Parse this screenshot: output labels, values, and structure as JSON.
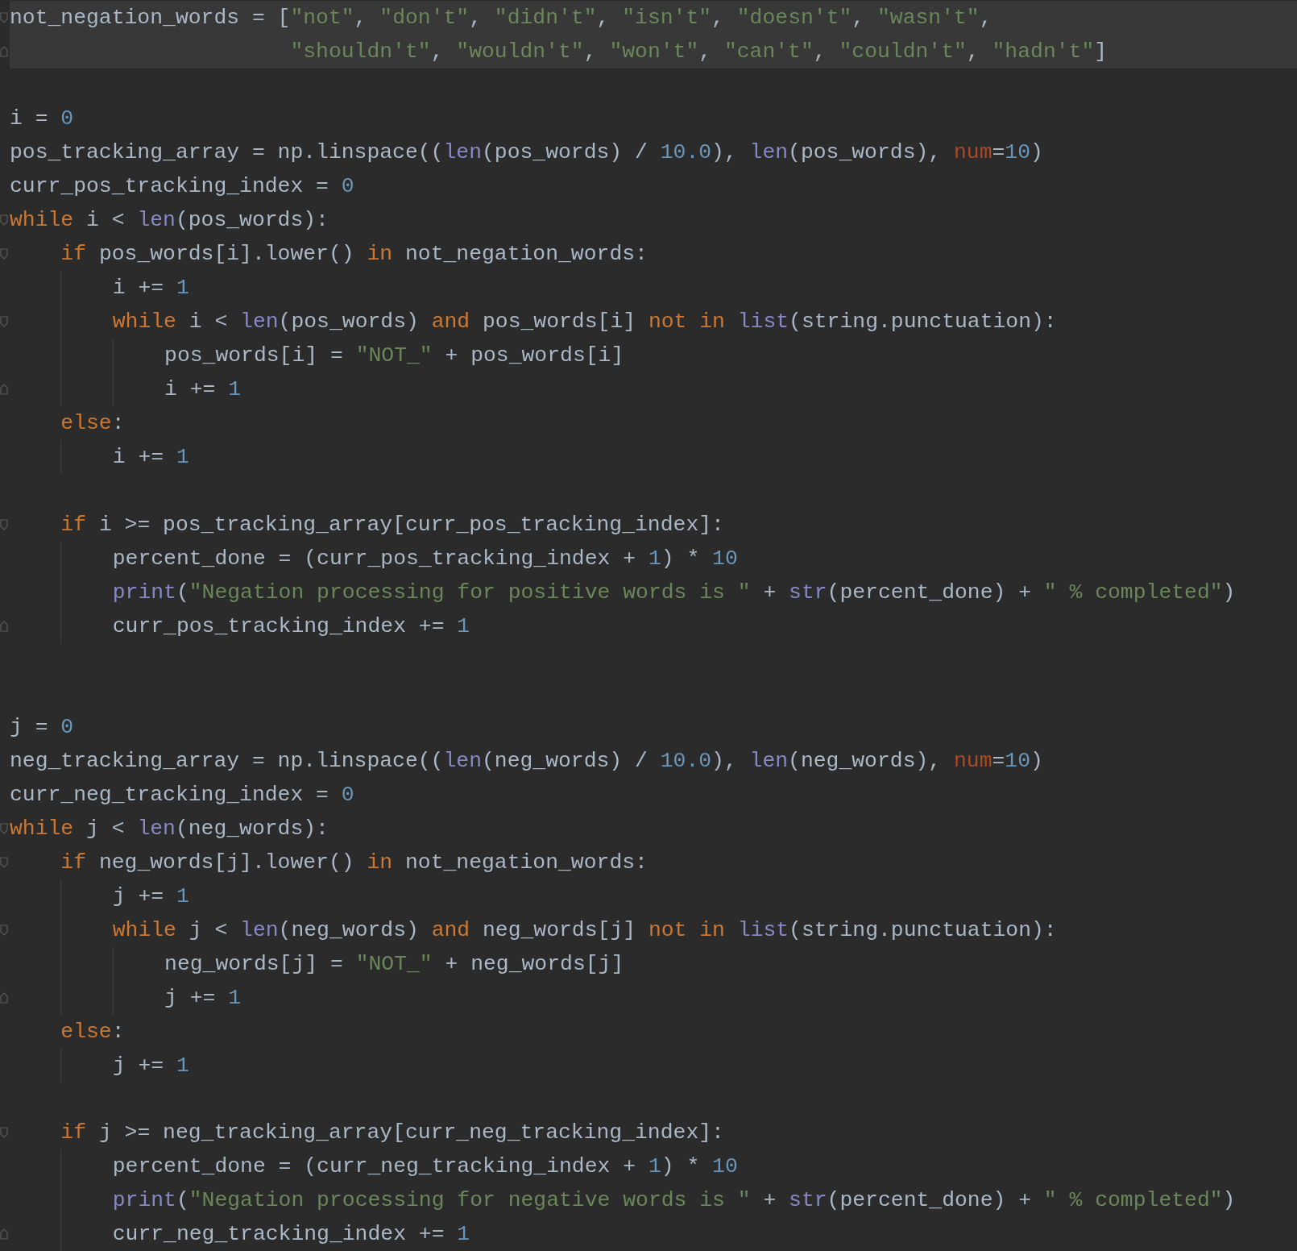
{
  "editor": {
    "lines": [
      {
        "kind": "code",
        "highlighted": true,
        "fold_open": true,
        "fold_close": false,
        "tokens": [
          {
            "kind": "plain",
            "text": "not_negation_words = ["
          },
          {
            "kind": "string",
            "text": "\"not\""
          },
          {
            "kind": "plain",
            "text": ", "
          },
          {
            "kind": "string",
            "text": "\"don't\""
          },
          {
            "kind": "plain",
            "text": ", "
          },
          {
            "kind": "string",
            "text": "\"didn't\""
          },
          {
            "kind": "plain",
            "text": ", "
          },
          {
            "kind": "string",
            "text": "\"isn't\""
          },
          {
            "kind": "plain",
            "text": ", "
          },
          {
            "kind": "string",
            "text": "\"doesn't\""
          },
          {
            "kind": "plain",
            "text": ", "
          },
          {
            "kind": "string",
            "text": "\"wasn't\""
          },
          {
            "kind": "plain",
            "text": ","
          }
        ]
      },
      {
        "kind": "code",
        "highlighted": true,
        "fold_open": false,
        "fold_close": true,
        "tokens": [
          {
            "kind": "string",
            "text": "                      \"shouldn't\""
          },
          {
            "kind": "plain",
            "text": ", "
          },
          {
            "kind": "string",
            "text": "\"wouldn't\""
          },
          {
            "kind": "plain",
            "text": ", "
          },
          {
            "kind": "string",
            "text": "\"won't\""
          },
          {
            "kind": "plain",
            "text": ", "
          },
          {
            "kind": "string",
            "text": "\"can't\""
          },
          {
            "kind": "plain",
            "text": ", "
          },
          {
            "kind": "string",
            "text": "\"couldn't\""
          },
          {
            "kind": "plain",
            "text": ", "
          },
          {
            "kind": "string",
            "text": "\"hadn't\""
          },
          {
            "kind": "plain",
            "text": "]"
          }
        ]
      },
      {
        "kind": "blank"
      },
      {
        "kind": "code",
        "highlighted": false,
        "fold_open": false,
        "fold_close": false,
        "tokens": [
          {
            "kind": "plain",
            "text": "i = "
          },
          {
            "kind": "number",
            "text": "0"
          }
        ]
      },
      {
        "kind": "code",
        "highlighted": false,
        "fold_open": false,
        "fold_close": false,
        "tokens": [
          {
            "kind": "plain",
            "text": "pos_tracking_array = np.linspace(("
          },
          {
            "kind": "builtin",
            "text": "len"
          },
          {
            "kind": "plain",
            "text": "(pos_words) / "
          },
          {
            "kind": "number",
            "text": "10.0"
          },
          {
            "kind": "plain",
            "text": "), "
          },
          {
            "kind": "builtin",
            "text": "len"
          },
          {
            "kind": "plain",
            "text": "(pos_words), "
          },
          {
            "kind": "param",
            "text": "num"
          },
          {
            "kind": "plain",
            "text": "="
          },
          {
            "kind": "number",
            "text": "10"
          },
          {
            "kind": "plain",
            "text": ")"
          }
        ]
      },
      {
        "kind": "code",
        "highlighted": false,
        "fold_open": false,
        "fold_close": false,
        "tokens": [
          {
            "kind": "plain",
            "text": "curr_pos_tracking_index = "
          },
          {
            "kind": "number",
            "text": "0"
          }
        ]
      },
      {
        "kind": "code",
        "highlighted": false,
        "fold_open": true,
        "fold_close": false,
        "tokens": [
          {
            "kind": "keyword",
            "text": "while"
          },
          {
            "kind": "plain",
            "text": " i < "
          },
          {
            "kind": "builtin",
            "text": "len"
          },
          {
            "kind": "plain",
            "text": "(pos_words):"
          }
        ]
      },
      {
        "kind": "code",
        "highlighted": false,
        "fold_open": true,
        "fold_close": false,
        "tokens": [
          {
            "kind": "keyword",
            "text": "    if"
          },
          {
            "kind": "plain",
            "text": " pos_words[i].lower() "
          },
          {
            "kind": "keyword",
            "text": "in"
          },
          {
            "kind": "plain",
            "text": " not_negation_words:"
          }
        ]
      },
      {
        "kind": "code",
        "highlighted": false,
        "fold_open": false,
        "fold_close": false,
        "tokens": [
          {
            "kind": "plain",
            "text": "        i += "
          },
          {
            "kind": "number",
            "text": "1"
          }
        ]
      },
      {
        "kind": "code",
        "highlighted": false,
        "fold_open": true,
        "fold_close": false,
        "tokens": [
          {
            "kind": "keyword",
            "text": "        while"
          },
          {
            "kind": "plain",
            "text": " i < "
          },
          {
            "kind": "builtin",
            "text": "len"
          },
          {
            "kind": "plain",
            "text": "(pos_words) "
          },
          {
            "kind": "keyword",
            "text": "and"
          },
          {
            "kind": "plain",
            "text": " pos_words[i] "
          },
          {
            "kind": "keyword",
            "text": "not in"
          },
          {
            "kind": "builtin",
            "text": " list"
          },
          {
            "kind": "plain",
            "text": "(string.punctuation):"
          }
        ]
      },
      {
        "kind": "code",
        "highlighted": false,
        "fold_open": false,
        "fold_close": false,
        "tokens": [
          {
            "kind": "plain",
            "text": "            pos_words[i] = "
          },
          {
            "kind": "string",
            "text": "\"NOT_\""
          },
          {
            "kind": "plain",
            "text": " + pos_words[i]"
          }
        ]
      },
      {
        "kind": "code",
        "highlighted": false,
        "fold_open": false,
        "fold_close": true,
        "tokens": [
          {
            "kind": "plain",
            "text": "            i += "
          },
          {
            "kind": "number",
            "text": "1"
          }
        ]
      },
      {
        "kind": "code",
        "highlighted": false,
        "fold_open": false,
        "fold_close": false,
        "tokens": [
          {
            "kind": "keyword",
            "text": "    else"
          },
          {
            "kind": "plain",
            "text": ":"
          }
        ]
      },
      {
        "kind": "code",
        "highlighted": false,
        "fold_open": false,
        "fold_close": false,
        "tokens": [
          {
            "kind": "plain",
            "text": "        i += "
          },
          {
            "kind": "number",
            "text": "1"
          }
        ]
      },
      {
        "kind": "blank"
      },
      {
        "kind": "code",
        "highlighted": false,
        "fold_open": true,
        "fold_close": false,
        "tokens": [
          {
            "kind": "keyword",
            "text": "    if"
          },
          {
            "kind": "plain",
            "text": " i >= pos_tracking_array[curr_pos_tracking_index]:"
          }
        ]
      },
      {
        "kind": "code",
        "highlighted": false,
        "fold_open": false,
        "fold_close": false,
        "tokens": [
          {
            "kind": "plain",
            "text": "        percent_done = (curr_pos_tracking_index + "
          },
          {
            "kind": "number",
            "text": "1"
          },
          {
            "kind": "plain",
            "text": ") * "
          },
          {
            "kind": "number",
            "text": "10"
          }
        ]
      },
      {
        "kind": "code",
        "highlighted": false,
        "fold_open": false,
        "fold_close": false,
        "tokens": [
          {
            "kind": "builtin",
            "text": "        print"
          },
          {
            "kind": "plain",
            "text": "("
          },
          {
            "kind": "string",
            "text": "\"Negation processing for positive words is \""
          },
          {
            "kind": "plain",
            "text": " + "
          },
          {
            "kind": "builtin",
            "text": "str"
          },
          {
            "kind": "plain",
            "text": "(percent_done) + "
          },
          {
            "kind": "string",
            "text": "\" % completed\""
          },
          {
            "kind": "plain",
            "text": ")"
          }
        ]
      },
      {
        "kind": "code",
        "highlighted": false,
        "fold_open": false,
        "fold_close": true,
        "tokens": [
          {
            "kind": "plain",
            "text": "        curr_pos_tracking_index += "
          },
          {
            "kind": "number",
            "text": "1"
          }
        ]
      },
      {
        "kind": "blank"
      },
      {
        "kind": "blank"
      },
      {
        "kind": "code",
        "highlighted": false,
        "fold_open": false,
        "fold_close": false,
        "tokens": [
          {
            "kind": "plain",
            "text": "j = "
          },
          {
            "kind": "number",
            "text": "0"
          }
        ]
      },
      {
        "kind": "code",
        "highlighted": false,
        "fold_open": false,
        "fold_close": false,
        "tokens": [
          {
            "kind": "plain",
            "text": "neg_tracking_array = np.linspace(("
          },
          {
            "kind": "builtin",
            "text": "len"
          },
          {
            "kind": "plain",
            "text": "(neg_words) / "
          },
          {
            "kind": "number",
            "text": "10.0"
          },
          {
            "kind": "plain",
            "text": "), "
          },
          {
            "kind": "builtin",
            "text": "len"
          },
          {
            "kind": "plain",
            "text": "(neg_words), "
          },
          {
            "kind": "param",
            "text": "num"
          },
          {
            "kind": "plain",
            "text": "="
          },
          {
            "kind": "number",
            "text": "10"
          },
          {
            "kind": "plain",
            "text": ")"
          }
        ]
      },
      {
        "kind": "code",
        "highlighted": false,
        "fold_open": false,
        "fold_close": false,
        "tokens": [
          {
            "kind": "plain",
            "text": "curr_neg_tracking_index = "
          },
          {
            "kind": "number",
            "text": "0"
          }
        ]
      },
      {
        "kind": "code",
        "highlighted": false,
        "fold_open": true,
        "fold_close": false,
        "tokens": [
          {
            "kind": "keyword",
            "text": "while"
          },
          {
            "kind": "plain",
            "text": " j < "
          },
          {
            "kind": "builtin",
            "text": "len"
          },
          {
            "kind": "plain",
            "text": "(neg_words):"
          }
        ]
      },
      {
        "kind": "code",
        "highlighted": false,
        "fold_open": true,
        "fold_close": false,
        "tokens": [
          {
            "kind": "keyword",
            "text": "    if"
          },
          {
            "kind": "plain",
            "text": " neg_words[j].lower() "
          },
          {
            "kind": "keyword",
            "text": "in"
          },
          {
            "kind": "plain",
            "text": " not_negation_words:"
          }
        ]
      },
      {
        "kind": "code",
        "highlighted": false,
        "fold_open": false,
        "fold_close": false,
        "tokens": [
          {
            "kind": "plain",
            "text": "        j += "
          },
          {
            "kind": "number",
            "text": "1"
          }
        ]
      },
      {
        "kind": "code",
        "highlighted": false,
        "fold_open": true,
        "fold_close": false,
        "tokens": [
          {
            "kind": "keyword",
            "text": "        while"
          },
          {
            "kind": "plain",
            "text": " j < "
          },
          {
            "kind": "builtin",
            "text": "len"
          },
          {
            "kind": "plain",
            "text": "(neg_words) "
          },
          {
            "kind": "keyword",
            "text": "and"
          },
          {
            "kind": "plain",
            "text": " neg_words[j] "
          },
          {
            "kind": "keyword",
            "text": "not in"
          },
          {
            "kind": "builtin",
            "text": " list"
          },
          {
            "kind": "plain",
            "text": "(string.punctuation):"
          }
        ]
      },
      {
        "kind": "code",
        "highlighted": false,
        "fold_open": false,
        "fold_close": false,
        "tokens": [
          {
            "kind": "plain",
            "text": "            neg_words[j] = "
          },
          {
            "kind": "string",
            "text": "\"NOT_\""
          },
          {
            "kind": "plain",
            "text": " + neg_words[j]"
          }
        ]
      },
      {
        "kind": "code",
        "highlighted": false,
        "fold_open": false,
        "fold_close": true,
        "tokens": [
          {
            "kind": "plain",
            "text": "            j += "
          },
          {
            "kind": "number",
            "text": "1"
          }
        ]
      },
      {
        "kind": "code",
        "highlighted": false,
        "fold_open": false,
        "fold_close": false,
        "tokens": [
          {
            "kind": "keyword",
            "text": "    else"
          },
          {
            "kind": "plain",
            "text": ":"
          }
        ]
      },
      {
        "kind": "code",
        "highlighted": false,
        "fold_open": false,
        "fold_close": false,
        "tokens": [
          {
            "kind": "plain",
            "text": "        j += "
          },
          {
            "kind": "number",
            "text": "1"
          }
        ]
      },
      {
        "kind": "blank"
      },
      {
        "kind": "code",
        "highlighted": false,
        "fold_open": true,
        "fold_close": false,
        "tokens": [
          {
            "kind": "keyword",
            "text": "    if"
          },
          {
            "kind": "plain",
            "text": " j >= neg_tracking_array[curr_neg_tracking_index]:"
          }
        ]
      },
      {
        "kind": "code",
        "highlighted": false,
        "fold_open": false,
        "fold_close": false,
        "tokens": [
          {
            "kind": "plain",
            "text": "        percent_done = (curr_neg_tracking_index + "
          },
          {
            "kind": "number",
            "text": "1"
          },
          {
            "kind": "plain",
            "text": ") * "
          },
          {
            "kind": "number",
            "text": "10"
          }
        ]
      },
      {
        "kind": "code",
        "highlighted": false,
        "fold_open": false,
        "fold_close": false,
        "tokens": [
          {
            "kind": "builtin",
            "text": "        print"
          },
          {
            "kind": "plain",
            "text": "("
          },
          {
            "kind": "string",
            "text": "\"Negation processing for negative words is \""
          },
          {
            "kind": "plain",
            "text": " + "
          },
          {
            "kind": "builtin",
            "text": "str"
          },
          {
            "kind": "plain",
            "text": "(percent_done) + "
          },
          {
            "kind": "string",
            "text": "\" % completed\""
          },
          {
            "kind": "plain",
            "text": ")"
          }
        ]
      },
      {
        "kind": "code",
        "highlighted": false,
        "fold_open": false,
        "fold_close": true,
        "tokens": [
          {
            "kind": "plain",
            "text": "        curr_neg_tracking_index += "
          },
          {
            "kind": "number",
            "text": "1"
          }
        ]
      }
    ]
  }
}
